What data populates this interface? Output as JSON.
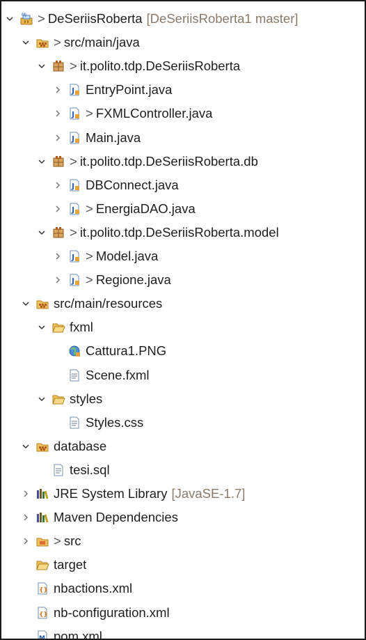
{
  "rows": [
    {
      "depth": 0,
      "tw": "down",
      "icon": "maven-project",
      "prefix": ">",
      "label": "DeSeriisRoberta",
      "deco": "[DeSeriisRoberta1 master]"
    },
    {
      "depth": 1,
      "tw": "down",
      "icon": "source-folder",
      "prefix": ">",
      "label": "src/main/java",
      "deco": ""
    },
    {
      "depth": 2,
      "tw": "down",
      "icon": "package",
      "prefix": ">",
      "label": "it.polito.tdp.DeSeriisRoberta",
      "deco": ""
    },
    {
      "depth": 3,
      "tw": "right",
      "icon": "java-file",
      "prefix": "",
      "label": "EntryPoint.java",
      "deco": ""
    },
    {
      "depth": 3,
      "tw": "right",
      "icon": "java-file",
      "prefix": ">",
      "label": "FXMLController.java",
      "deco": ""
    },
    {
      "depth": 3,
      "tw": "right",
      "icon": "java-file",
      "prefix": "",
      "label": "Main.java",
      "deco": ""
    },
    {
      "depth": 2,
      "tw": "down",
      "icon": "package",
      "prefix": ">",
      "label": "it.polito.tdp.DeSeriisRoberta.db",
      "deco": ""
    },
    {
      "depth": 3,
      "tw": "right",
      "icon": "java-file",
      "prefix": "",
      "label": "DBConnect.java",
      "deco": ""
    },
    {
      "depth": 3,
      "tw": "right",
      "icon": "java-file",
      "prefix": ">",
      "label": "EnergiaDAO.java",
      "deco": ""
    },
    {
      "depth": 2,
      "tw": "down",
      "icon": "package",
      "prefix": ">",
      "label": "it.polito.tdp.DeSeriisRoberta.model",
      "deco": ""
    },
    {
      "depth": 3,
      "tw": "right",
      "icon": "java-file",
      "prefix": ">",
      "label": "Model.java",
      "deco": ""
    },
    {
      "depth": 3,
      "tw": "right",
      "icon": "java-file",
      "prefix": ">",
      "label": "Regione.java",
      "deco": ""
    },
    {
      "depth": 1,
      "tw": "down",
      "icon": "source-folder",
      "prefix": "",
      "label": "src/main/resources",
      "deco": ""
    },
    {
      "depth": 2,
      "tw": "down",
      "icon": "folder-open",
      "prefix": "",
      "label": "fxml",
      "deco": ""
    },
    {
      "depth": 3,
      "tw": "none",
      "icon": "image-file",
      "prefix": "",
      "label": "Cattura1.PNG",
      "deco": ""
    },
    {
      "depth": 3,
      "tw": "none",
      "icon": "text-file",
      "prefix": "",
      "label": "Scene.fxml",
      "deco": ""
    },
    {
      "depth": 2,
      "tw": "down",
      "icon": "folder-open",
      "prefix": "",
      "label": "styles",
      "deco": ""
    },
    {
      "depth": 3,
      "tw": "none",
      "icon": "text-file",
      "prefix": "",
      "label": "Styles.css",
      "deco": ""
    },
    {
      "depth": 1,
      "tw": "down",
      "icon": "source-folder",
      "prefix": "",
      "label": "database",
      "deco": ""
    },
    {
      "depth": 2,
      "tw": "none",
      "icon": "text-file",
      "prefix": "",
      "label": "tesi.sql",
      "deco": ""
    },
    {
      "depth": 1,
      "tw": "right",
      "icon": "library",
      "prefix": "",
      "label": "JRE System Library",
      "deco": "[JavaSE-1.7]"
    },
    {
      "depth": 1,
      "tw": "right",
      "icon": "library",
      "prefix": "",
      "label": "Maven Dependencies",
      "deco": ""
    },
    {
      "depth": 1,
      "tw": "right",
      "icon": "folder-project",
      "prefix": ">",
      "label": "src",
      "deco": ""
    },
    {
      "depth": 1,
      "tw": "none",
      "icon": "folder-plain",
      "prefix": "",
      "label": "target",
      "deco": ""
    },
    {
      "depth": 1,
      "tw": "none",
      "icon": "xml-file",
      "prefix": "",
      "label": "nbactions.xml",
      "deco": ""
    },
    {
      "depth": 1,
      "tw": "none",
      "icon": "xml-file",
      "prefix": "",
      "label": "nb-configuration.xml",
      "deco": ""
    },
    {
      "depth": 1,
      "tw": "none",
      "icon": "pom-file",
      "prefix": "",
      "label": "pom.xml",
      "deco": ""
    }
  ]
}
